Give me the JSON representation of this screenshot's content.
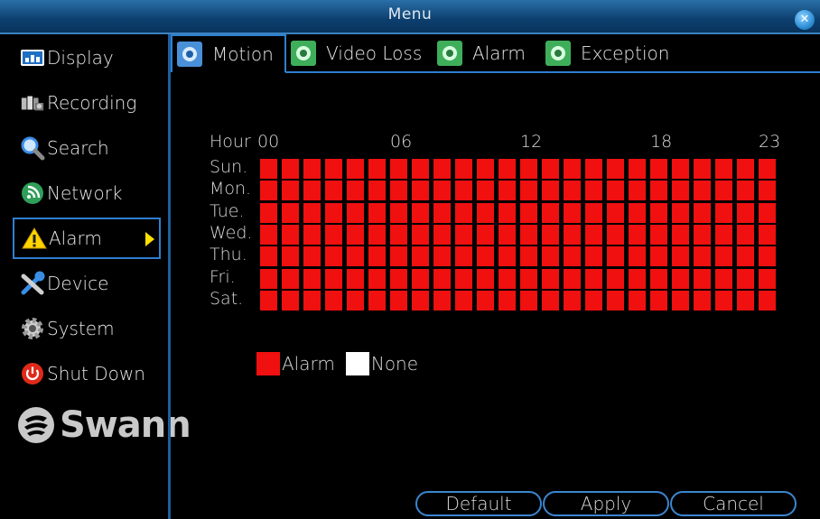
{
  "window": {
    "title": "Menu"
  },
  "sidebar": {
    "items": [
      {
        "label": "Display",
        "icon": "display-icon",
        "active": false
      },
      {
        "label": "Recording",
        "icon": "recording-icon",
        "active": false
      },
      {
        "label": "Search",
        "icon": "search-icon",
        "active": false
      },
      {
        "label": "Network",
        "icon": "network-icon",
        "active": false
      },
      {
        "label": "Alarm",
        "icon": "warning-icon",
        "active": true
      },
      {
        "label": "Device",
        "icon": "tools-icon",
        "active": false
      },
      {
        "label": "System",
        "icon": "gear-icon",
        "active": false
      },
      {
        "label": "Shut Down",
        "icon": "power-icon",
        "active": false
      }
    ],
    "logo": "Swann"
  },
  "tabs": [
    {
      "label": "Motion",
      "active": true
    },
    {
      "label": "Video Loss",
      "active": false
    },
    {
      "label": "Alarm",
      "active": false
    },
    {
      "label": "Exception",
      "active": false
    }
  ],
  "schedule": {
    "hour_label": "Hour",
    "hour_ticks": [
      "00",
      "06",
      "12",
      "18",
      "23"
    ],
    "days": [
      "Sun.",
      "Mon.",
      "Tue.",
      "Wed.",
      "Thu.",
      "Fri.",
      "Sat."
    ],
    "hours_per_day": 24,
    "all_cells_state": "alarm"
  },
  "legend": {
    "alarm": {
      "label": "Alarm",
      "color": "#f01010"
    },
    "none": {
      "label": "None",
      "color": "#ffffff"
    }
  },
  "buttons": {
    "default": "Default",
    "apply": "Apply",
    "cancel": "Cancel"
  },
  "colors": {
    "accent": "#2f7fd0",
    "alarm": "#f01010",
    "active_arrow": "#ffe000"
  }
}
